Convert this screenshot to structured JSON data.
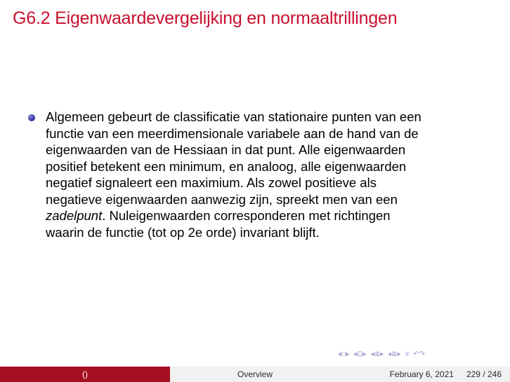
{
  "slide": {
    "title": "G6.2 Eigenwaardevergelijking en normaaltrillingen",
    "bullet_lines": {
      "l1": "Algemeen gebeurt de classificatie van stationaire punten van een",
      "l2": "functie van een meerdimensionale variabele aan de hand van de",
      "l3": "eigenwaarden van de Hessiaan in dat punt. Alle eigenwaarden",
      "l4": "positief betekent een minimum, en analoog, alle eigenwaarden",
      "l5": "negatief signaleert een maximium. Als zowel positieve als",
      "l6": "negatieve eigenwaarden aanwezig zijn, spreekt men van een",
      "l7_italic": "zadelpunt",
      "l7_rest": ". Nuleigenwaarden corresponderen met richtingen",
      "l8": "waarin de functie (tot op 2e orde) invariant blijft."
    }
  },
  "nav": {
    "icons": [
      "nav-first-icon",
      "nav-frame-icon",
      "nav-subsection-icon",
      "nav-section-icon",
      "nav-slide-icon",
      "nav-find-icon"
    ],
    "symbols": {
      "a": "◂",
      "b": "□",
      "c": "▸",
      "d": "◂",
      "e": "⊡",
      "f": "▸",
      "g": "◂",
      "h": "≣",
      "i": "▸",
      "j": "◂",
      "k": "≣",
      "l": "▸",
      "m": "≡",
      "n": "↶↷"
    }
  },
  "footer": {
    "author": "()",
    "section": "Overview",
    "date": "February 6, 2021",
    "page": "229 / 246"
  },
  "colors": {
    "title": "#c8102e",
    "footer_left": "#a50f20",
    "footer_right": "#f1f1f1",
    "bullet": "#3b3ba6"
  }
}
